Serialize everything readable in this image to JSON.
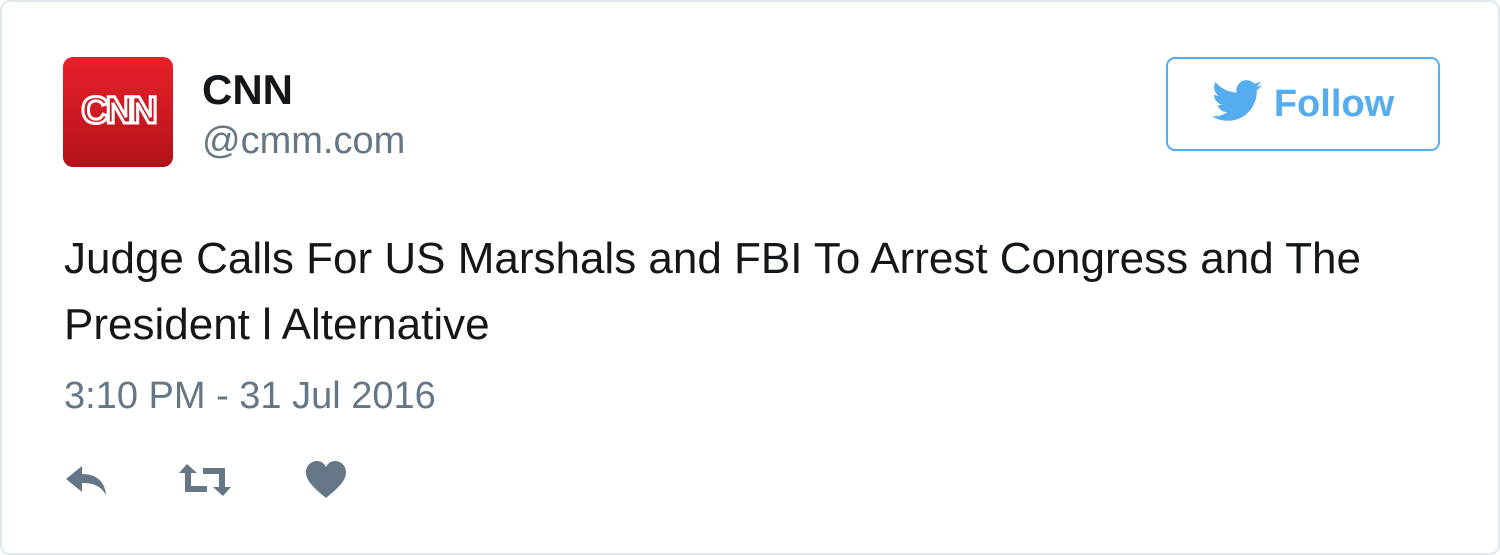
{
  "tweet": {
    "author": {
      "name": "CNN",
      "handle": "@cmm.com",
      "avatar": {
        "icon": "cnn-logo-icon",
        "logo_text": "CNN",
        "color": "#cc0000"
      }
    },
    "follow_button": {
      "label": "Follow",
      "icon": "twitter-bird-icon",
      "color": "#55acee"
    },
    "text": "Judge Calls For US Marshals and FBI To Arrest Congress and The President l Alternative",
    "timestamp": "3:10 PM - 31 Jul 2016",
    "actions": [
      {
        "name": "reply",
        "icon": "reply-icon"
      },
      {
        "name": "retweet",
        "icon": "retweet-icon"
      },
      {
        "name": "like",
        "icon": "heart-icon"
      }
    ],
    "colors": {
      "text": "#14171a",
      "secondary": "#657786",
      "border": "#e1e8ed"
    }
  }
}
